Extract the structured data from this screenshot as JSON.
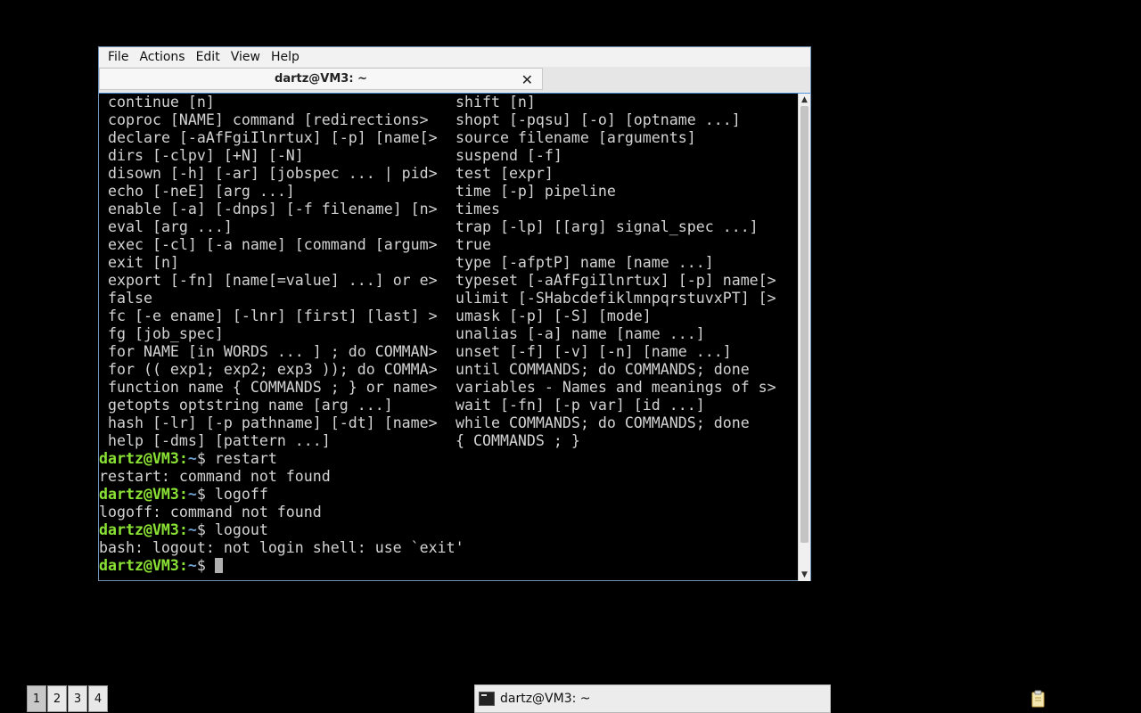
{
  "menu": [
    "File",
    "Actions",
    "Edit",
    "View",
    "Help"
  ],
  "tab": {
    "title": "dartz@VM3: ~",
    "close_glyph": "✕"
  },
  "help_rows": [
    [
      "continue [n]",
      "shift [n]"
    ],
    [
      "coproc [NAME] command [redirections>",
      "shopt [-pqsu] [-o] [optname ...]"
    ],
    [
      "declare [-aAfFgiIlnrtux] [-p] [name[>",
      "source filename [arguments]"
    ],
    [
      "dirs [-clpv] [+N] [-N]",
      "suspend [-f]"
    ],
    [
      "disown [-h] [-ar] [jobspec ... | pid>",
      "test [expr]"
    ],
    [
      "echo [-neE] [arg ...]",
      "time [-p] pipeline"
    ],
    [
      "enable [-a] [-dnps] [-f filename] [n>",
      "times"
    ],
    [
      "eval [arg ...]",
      "trap [-lp] [[arg] signal_spec ...]"
    ],
    [
      "exec [-cl] [-a name] [command [argum>",
      "true"
    ],
    [
      "exit [n]",
      "type [-afptP] name [name ...]"
    ],
    [
      "export [-fn] [name[=value] ...] or e>",
      "typeset [-aAfFgiIlnrtux] [-p] name[>"
    ],
    [
      "false",
      "ulimit [-SHabcdefiklmnpqrstuvxPT] [>"
    ],
    [
      "fc [-e ename] [-lnr] [first] [last] >",
      "umask [-p] [-S] [mode]"
    ],
    [
      "fg [job_spec]",
      "unalias [-a] name [name ...]"
    ],
    [
      "for NAME [in WORDS ... ] ; do COMMAN>",
      "unset [-f] [-v] [-n] [name ...]"
    ],
    [
      "for (( exp1; exp2; exp3 )); do COMMA>",
      "until COMMANDS; do COMMANDS; done"
    ],
    [
      "function name { COMMANDS ; } or name>",
      "variables - Names and meanings of s>"
    ],
    [
      "getopts optstring name [arg ...]",
      "wait [-fn] [-p var] [id ...]"
    ],
    [
      "hash [-lr] [-p pathname] [-dt] [name>",
      "while COMMANDS; do COMMANDS; done"
    ],
    [
      "help [-dms] [pattern ...]",
      "{ COMMANDS ; }"
    ]
  ],
  "prompt": {
    "user_host": "dartz@VM3",
    "sep": ":",
    "dir": "~",
    "symbol": "$ "
  },
  "session": [
    {
      "command": "restart",
      "output": "restart: command not found"
    },
    {
      "command": "logoff",
      "output": "logoff: command not found"
    },
    {
      "command": "logout",
      "output": "bash: logout: not login shell: use `exit'"
    }
  ],
  "taskbar": {
    "workspaces": [
      "1",
      "2",
      "3",
      "4"
    ],
    "active_workspace": "1",
    "task_title": "dartz@VM3: ~"
  }
}
